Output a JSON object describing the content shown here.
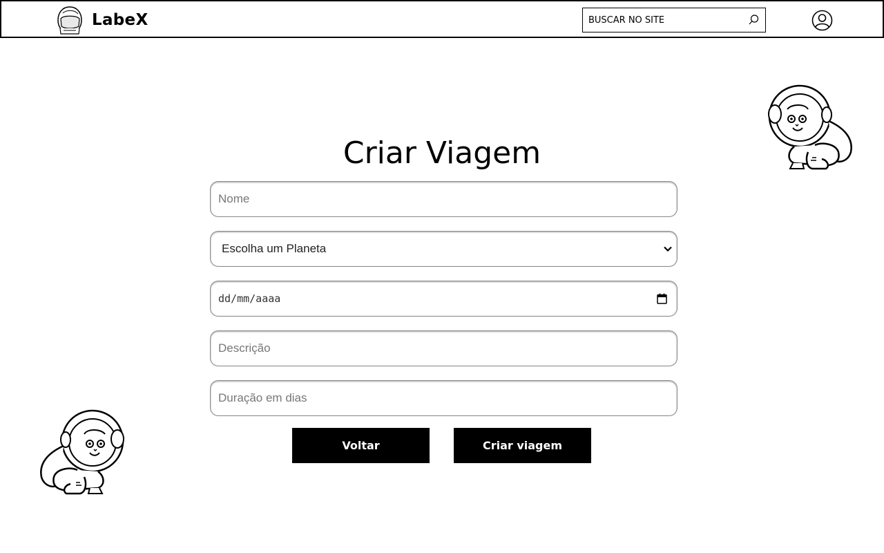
{
  "header": {
    "brand": "LabeX",
    "search_placeholder": "BUSCAR NO SITE",
    "logo_icon": "astronaut-helmet-icon",
    "search_icon": "search-icon",
    "user_icon": "user-icon"
  },
  "main": {
    "title": "Criar Viagem",
    "fields": {
      "nome_placeholder": "Nome",
      "planeta_selected": "Escolha um Planeta",
      "data_placeholder": "dd/mm/aaaa",
      "descricao_placeholder": "Descrição",
      "duracao_placeholder": "Duração em dias"
    },
    "buttons": {
      "voltar": "Voltar",
      "criar": "Criar viagem"
    }
  },
  "decorations": [
    "astronaut-monkey-icon",
    "astronaut-monkey-icon"
  ],
  "colors": {
    "button_bg": "#000000",
    "button_text": "#ffffff",
    "border": "#000000"
  }
}
